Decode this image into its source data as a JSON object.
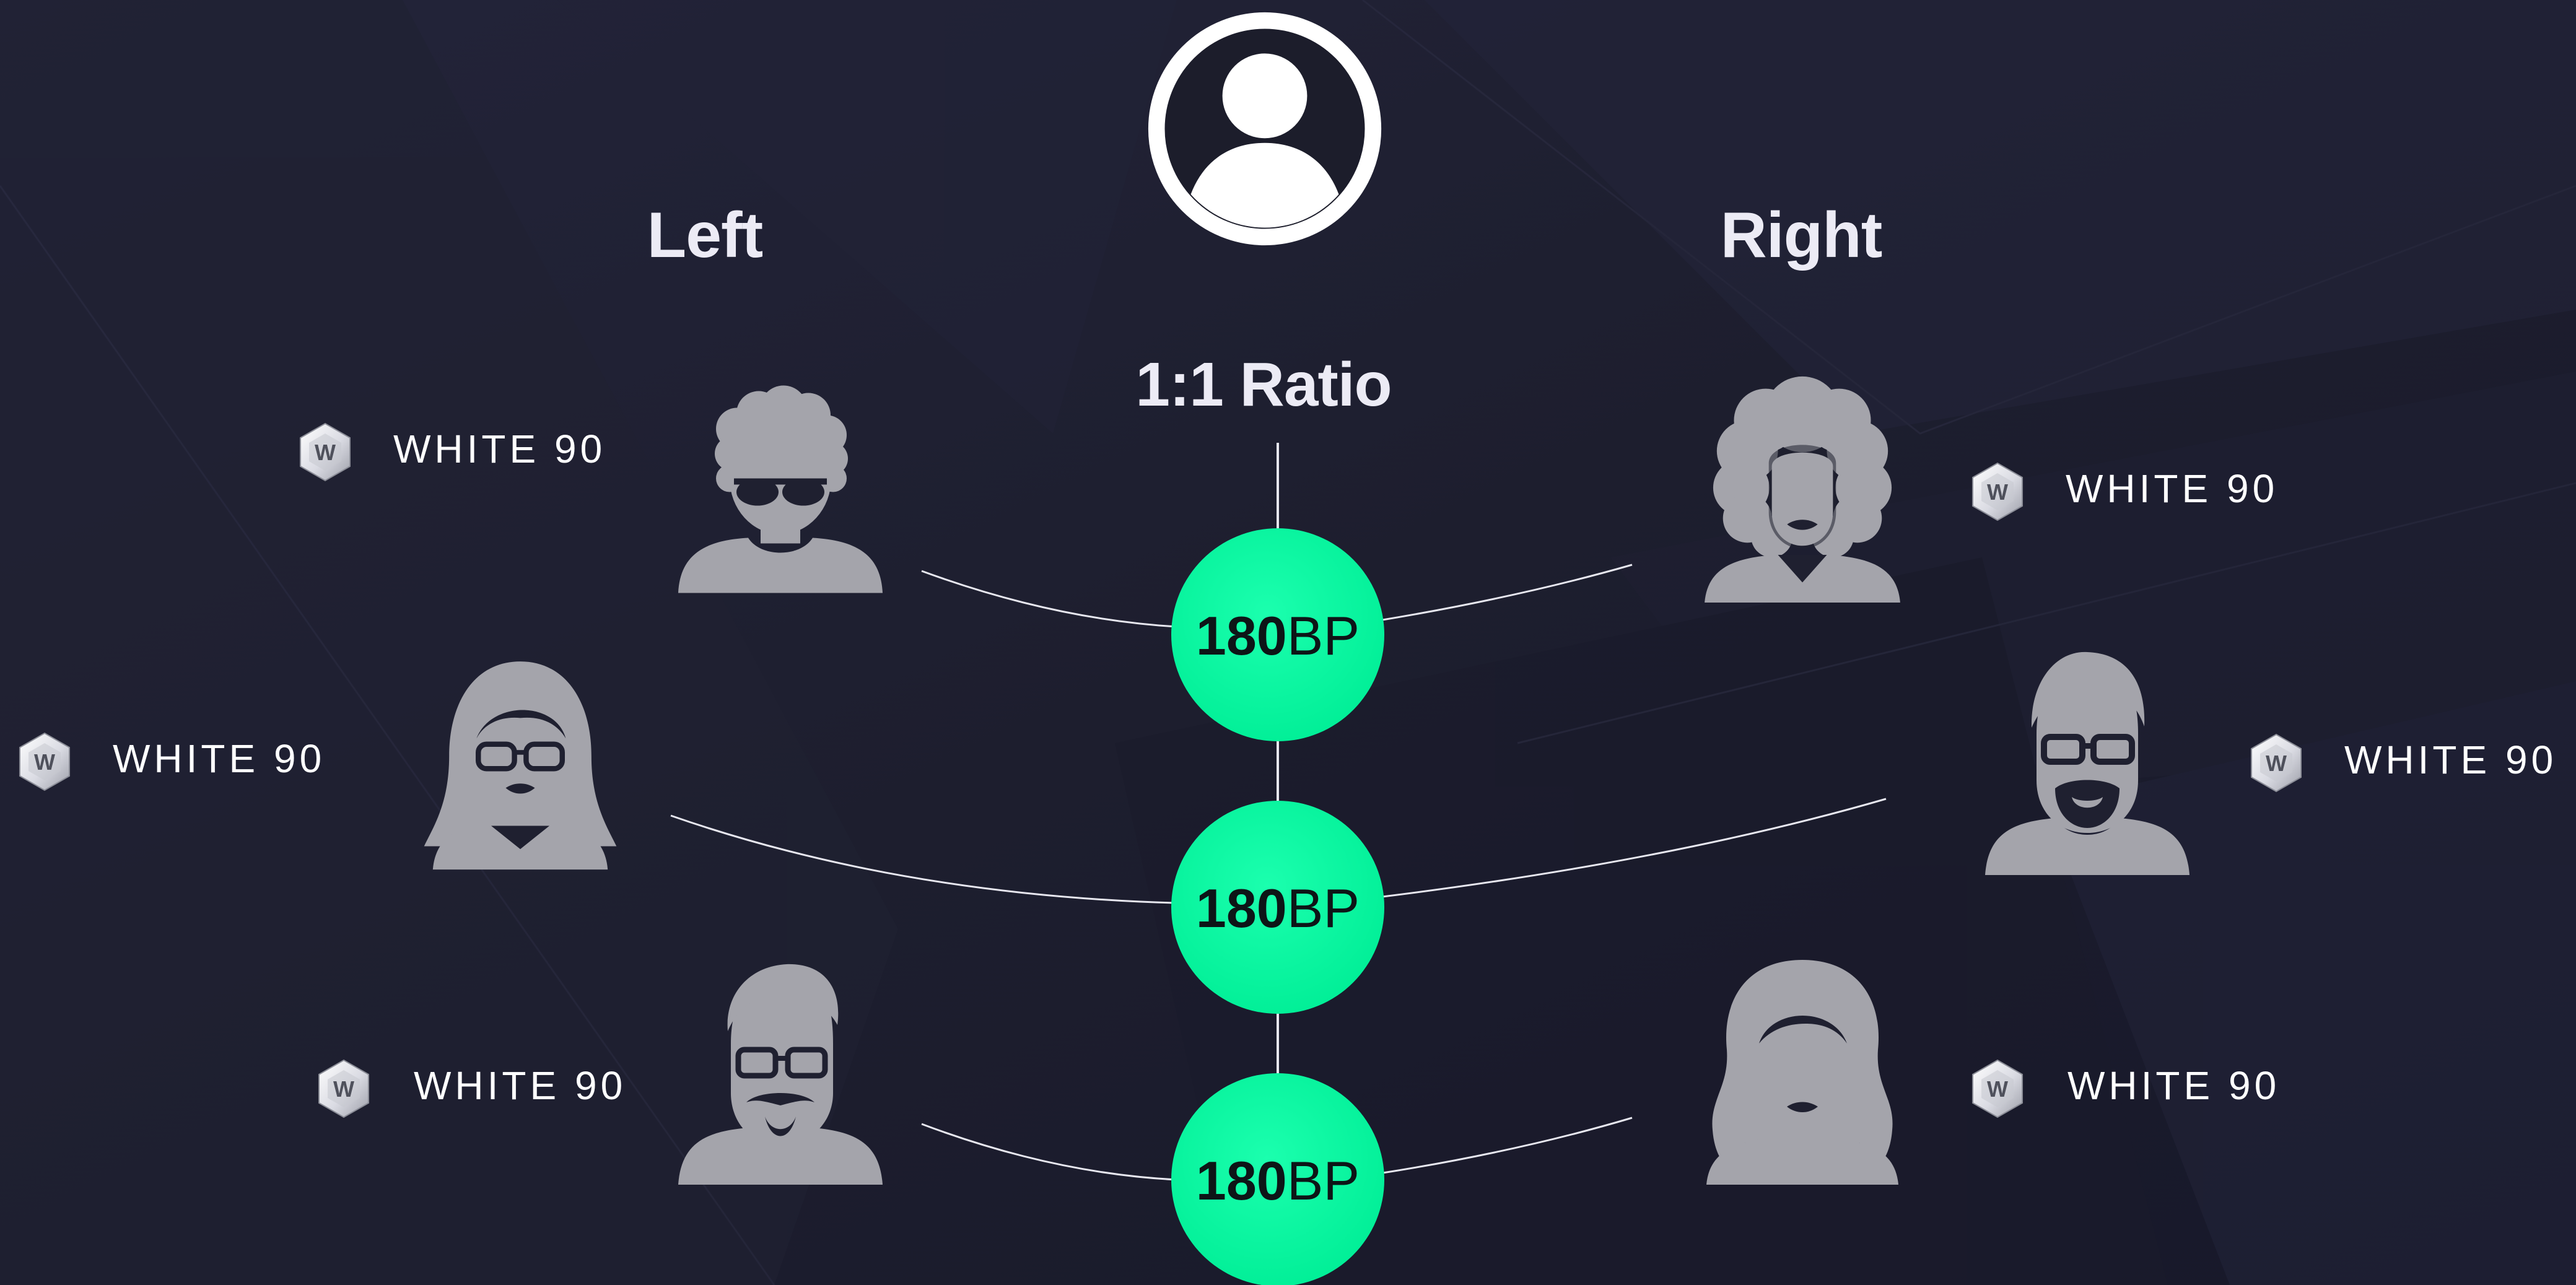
{
  "header": {
    "avatar_icon": "user-circle-icon",
    "left_heading": "Left",
    "right_heading": "Right",
    "ratio_label": "1:1 Ratio"
  },
  "colors": {
    "background": "#1c1d2b",
    "node_fill": "#00f59b",
    "avatar_fill": "#a4a4ab",
    "text": "#ecebf5"
  },
  "nodes": [
    {
      "value": "180",
      "unit": "BP"
    },
    {
      "value": "180",
      "unit": "BP"
    },
    {
      "value": "180",
      "unit": "BP"
    }
  ],
  "left": [
    {
      "avatar_icon": "man-curly-hair-sunglasses-icon",
      "badge_icon": "w-hexagon-badge-icon",
      "badge_letter": "W",
      "label": "WHITE 90"
    },
    {
      "avatar_icon": "woman-glasses-icon",
      "badge_icon": "w-hexagon-badge-icon",
      "badge_letter": "W",
      "label": "WHITE 90"
    },
    {
      "avatar_icon": "man-glasses-beard-icon",
      "badge_icon": "w-hexagon-badge-icon",
      "badge_letter": "W",
      "label": "WHITE 90"
    }
  ],
  "right": [
    {
      "avatar_icon": "woman-curly-hair-icon",
      "badge_icon": "w-hexagon-badge-icon",
      "badge_letter": "W",
      "label": "WHITE 90"
    },
    {
      "avatar_icon": "man-glasses-goatee-icon",
      "badge_icon": "w-hexagon-badge-icon",
      "badge_letter": "W",
      "label": "WHITE 90"
    },
    {
      "avatar_icon": "woman-wavy-hair-icon",
      "badge_icon": "w-hexagon-badge-icon",
      "badge_letter": "W",
      "label": "WHITE 90"
    }
  ]
}
